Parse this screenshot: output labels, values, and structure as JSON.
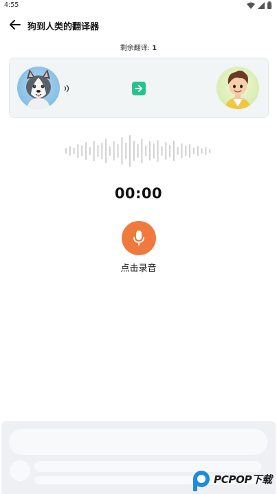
{
  "status_bar": {
    "time": "4:55"
  },
  "header": {
    "title": "狗到人类的翻译器"
  },
  "remaining": {
    "label": "剩余翻译:",
    "count": "1"
  },
  "translator": {
    "from": "dog",
    "to": "human",
    "swap_icon": "arrow-right-icon"
  },
  "timer": "00:00",
  "record": {
    "label": "点击录音",
    "color": "#f07a3e"
  },
  "accent_colors": {
    "swap": "#28c28f",
    "mic": "#f07a3e"
  },
  "watermark": {
    "text": "PCPOP下载"
  }
}
